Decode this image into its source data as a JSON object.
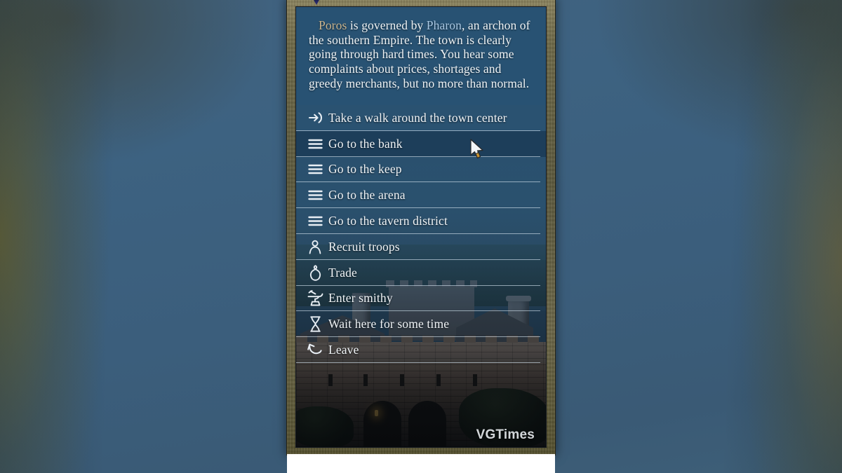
{
  "dialog": {
    "description": {
      "full_text": "Poros is governed by Pharon, an archon of the southern Empire. The town is clearly going through hard times. You hear some complaints about prices, shortages and greedy merchants, but no more than normal.",
      "town_name": "Poros",
      "ruler_name": "Pharon",
      "segment_1": " is governed by ",
      "segment_2": ", an archon of the southern Empire. The town is clearly going through hard times. You hear some complaints about prices, shortages and greedy merchants, but no more than normal."
    },
    "options": [
      {
        "label": "Take a walk around the town center",
        "icon": "enter-arrow-icon",
        "selected": false
      },
      {
        "label": "Go to the bank",
        "icon": "list-lines-icon",
        "selected": true
      },
      {
        "label": "Go to the keep",
        "icon": "list-lines-icon",
        "selected": false
      },
      {
        "label": "Go to the arena",
        "icon": "list-lines-icon",
        "selected": false
      },
      {
        "label": "Go to the tavern district",
        "icon": "list-lines-icon",
        "selected": false
      },
      {
        "label": "Recruit troops",
        "icon": "person-icon",
        "selected": false
      },
      {
        "label": "Trade",
        "icon": "coin-purse-icon",
        "selected": false
      },
      {
        "label": "Enter smithy",
        "icon": "anvil-icon",
        "selected": false
      },
      {
        "label": "Wait here for some time",
        "icon": "hourglass-icon",
        "selected": false
      },
      {
        "label": "Leave",
        "icon": "back-arrow-icon",
        "selected": false
      }
    ]
  },
  "watermark": {
    "text": "VGTimes"
  },
  "colors": {
    "panel_blue": "#2c5575",
    "selected_blue": "#1b3c58",
    "frame_gold": "#6c6749",
    "town_name": "#c9b48e",
    "ruler_name": "#a9c8e4",
    "text": "#f0f4f7",
    "separator": "#d6e5f0",
    "gem_purple": "#2a2f75"
  }
}
